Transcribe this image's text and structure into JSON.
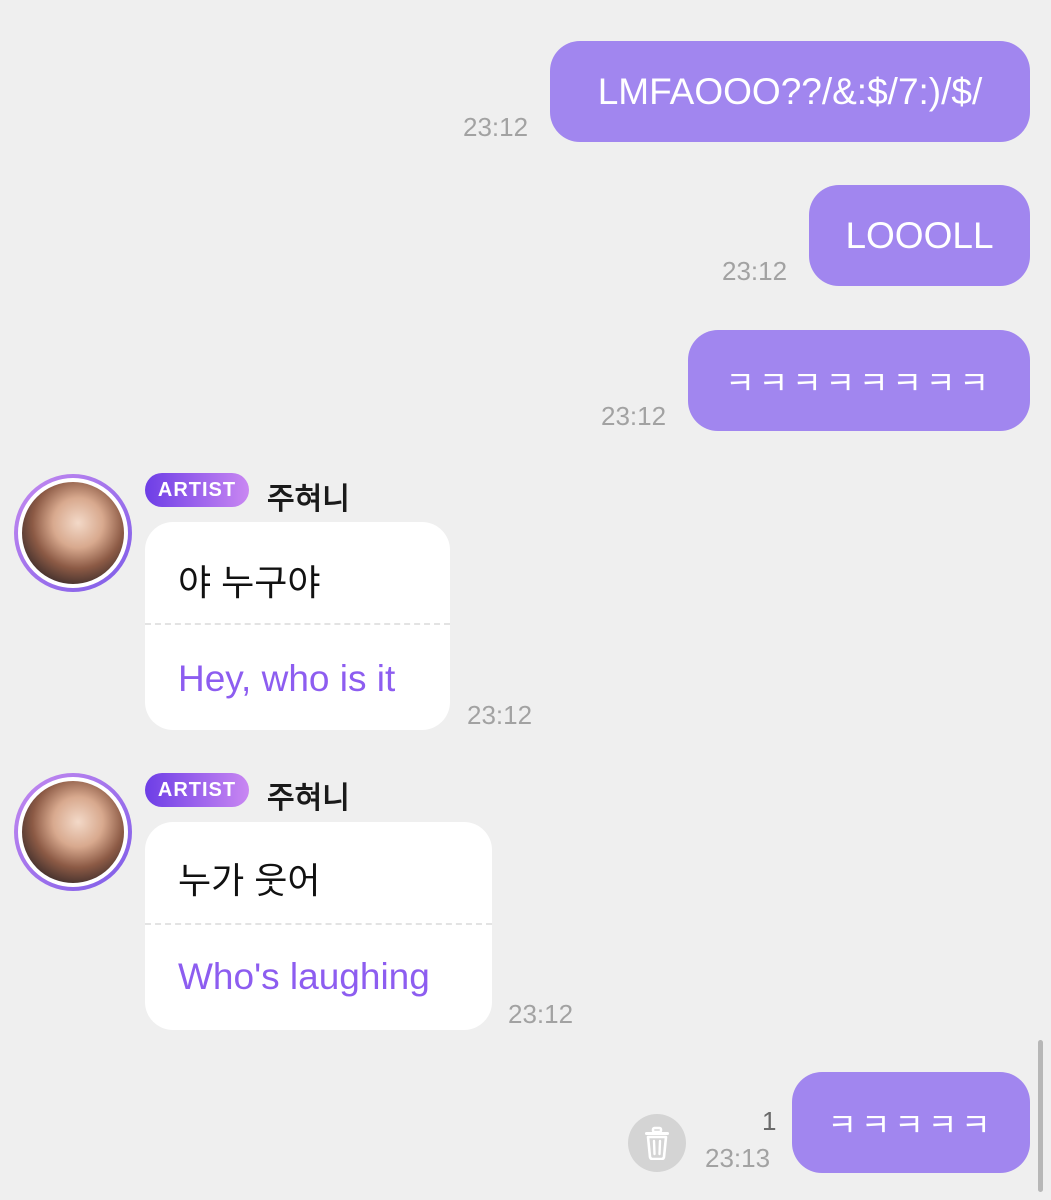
{
  "messages_out": [
    {
      "text": "LMFAOOO??/&:$/7:)/$/",
      "time": "23:12"
    },
    {
      "text": "LOOOLL",
      "time": "23:12"
    },
    {
      "text": "ㅋㅋㅋㅋㅋㅋㅋㅋ",
      "time": "23:12"
    }
  ],
  "messages_in": [
    {
      "badge": "ARTIST",
      "name": "주혀니",
      "original": "야 누구야",
      "translation": "Hey, who is it",
      "time": "23:12"
    },
    {
      "badge": "ARTIST",
      "name": "주혀니",
      "original": "누가 웃어",
      "translation": "Who's laughing",
      "time": "23:12"
    }
  ],
  "last_message": {
    "text": "ㅋㅋㅋㅋㅋ",
    "time": "23:13",
    "unread_count": "1"
  },
  "icons": {
    "delete": "trash-icon"
  },
  "colors": {
    "outgoing_bubble": "#a186ef",
    "translation_text": "#8d5df0",
    "background": "#efefef"
  }
}
